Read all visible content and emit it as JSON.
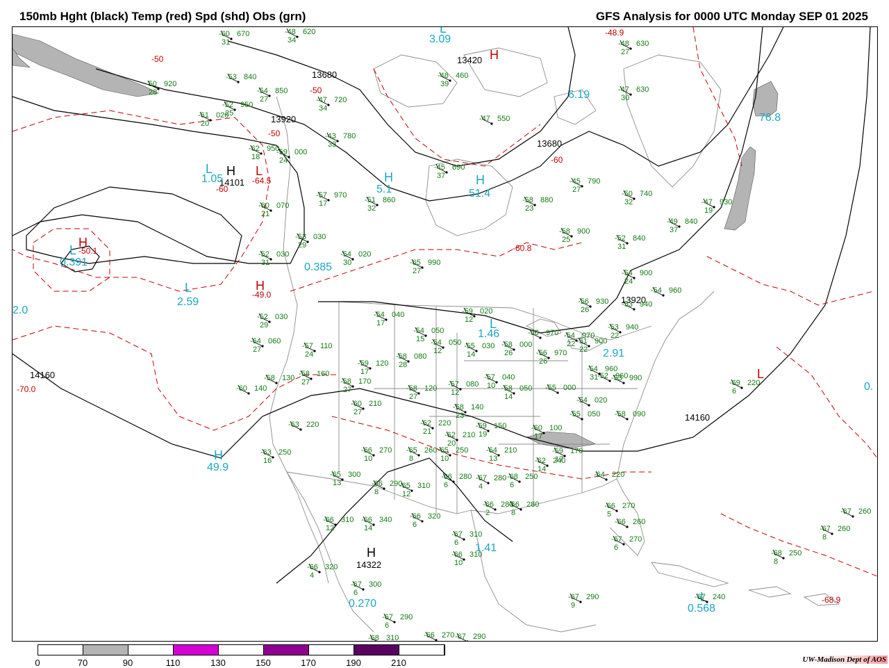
{
  "header": {
    "title_left": "150mb Hght (black) Temp (red) Spd (shd) Obs (grn)",
    "title_right": "GFS Analysis for 0000 UTC Monday  SEP 01 2025"
  },
  "colors": {
    "height_contour": "#000000",
    "temp_contour": "#c00000",
    "obs_text": "#117a11",
    "speed_center_label": "#1aa7c0",
    "map_lines": "#8c8c8c"
  },
  "map": {
    "height_labels": [
      "13680",
      "13920",
      "14101",
      "13920",
      "13680",
      "14160",
      "14160",
      "14322",
      "13420"
    ],
    "temp_labels": [
      "-50",
      "-50",
      "-50",
      "-60",
      "-64.5",
      "-50.1",
      "-49.0",
      "-60.8",
      "-48.9",
      "-70.0",
      "-68.9",
      "-60"
    ],
    "speed_centers": [
      "3.09",
      "6.19",
      "1.05",
      "0.391",
      "2.59",
      "2.0",
      "5.1",
      "51.4",
      "0.385",
      "1.46",
      "2.91",
      "49.9",
      "76.8",
      "1.41",
      "0.270",
      "0.568",
      "0."
    ],
    "pressure_centers": [
      "H",
      "L",
      "H",
      "L",
      "H",
      "L",
      "H",
      "L",
      "H",
      "L",
      "H",
      "L",
      "H",
      "H",
      "L",
      "L"
    ],
    "stations": [
      {
        "t": "-60",
        "h": "670",
        "s": "31"
      },
      {
        "t": "-48",
        "h": "620",
        "s": "34"
      },
      {
        "t": "-50",
        "h": "920",
        "s": "28"
      },
      {
        "t": "-53",
        "h": "840",
        "s": ""
      },
      {
        "t": "-54",
        "h": "850",
        "s": "27"
      },
      {
        "t": "-52",
        "h": "950",
        "s": "25"
      },
      {
        "t": "-61",
        "h": "020",
        "s": "20"
      },
      {
        "t": "-62",
        "h": "950",
        "s": "18"
      },
      {
        "t": "-59",
        "h": "000",
        "s": "24"
      },
      {
        "t": "-47",
        "h": "720",
        "s": "34"
      },
      {
        "t": "-43",
        "h": "780",
        "s": "33"
      },
      {
        "t": "-57",
        "h": "970",
        "s": "17"
      },
      {
        "t": "-51",
        "h": "860",
        "s": "32"
      },
      {
        "t": "-60",
        "h": "070",
        "s": "21"
      },
      {
        "t": "-53",
        "h": "030",
        "s": "29"
      },
      {
        "t": "-54",
        "h": "020",
        "s": "30"
      },
      {
        "t": "-52",
        "h": "030",
        "s": "31"
      },
      {
        "t": "-65",
        "h": "990",
        "s": "27"
      },
      {
        "t": "-48",
        "h": "460",
        "s": "39"
      },
      {
        "t": "-47",
        "h": "550",
        "s": ""
      },
      {
        "t": "-45",
        "h": "690",
        "s": "37"
      },
      {
        "t": "-48",
        "h": "630",
        "s": "27"
      },
      {
        "t": "-47",
        "h": "630",
        "s": "30"
      },
      {
        "t": "-58",
        "h": "880",
        "s": "23"
      },
      {
        "t": "-45",
        "h": "790",
        "s": "27"
      },
      {
        "t": "-50",
        "h": "740",
        "s": "32"
      },
      {
        "t": "-47",
        "h": "930",
        "s": "19"
      },
      {
        "t": "-49",
        "h": "840",
        "s": "37"
      },
      {
        "t": "-58",
        "h": "900",
        "s": "25"
      },
      {
        "t": "-52",
        "h": "840",
        "s": "31"
      },
      {
        "t": "-54",
        "h": "900",
        "s": "24"
      },
      {
        "t": "-54",
        "h": "960",
        "s": ""
      },
      {
        "t": "-56",
        "h": "930",
        "s": "26"
      },
      {
        "t": "-53",
        "h": "940",
        "s": ""
      },
      {
        "t": "-52",
        "h": "030",
        "s": "29"
      },
      {
        "t": "-64",
        "h": "060",
        "s": "27"
      },
      {
        "t": "-57",
        "h": "110",
        "s": "24"
      },
      {
        "t": "-54",
        "h": "040",
        "s": "17"
      },
      {
        "t": "-54",
        "h": "050",
        "s": "15"
      },
      {
        "t": "-54",
        "h": "050",
        "s": "12"
      },
      {
        "t": "-59",
        "h": "020",
        "s": "12"
      },
      {
        "t": "-55",
        "h": "030",
        "s": "14"
      },
      {
        "t": "-58",
        "h": "000",
        "s": "26"
      },
      {
        "t": "-56",
        "h": "970",
        "s": ""
      },
      {
        "t": "-56",
        "h": "970",
        "s": "26"
      },
      {
        "t": "-54",
        "h": "970",
        "s": "22"
      },
      {
        "t": "-53",
        "h": "940",
        "s": "22"
      },
      {
        "t": "-51",
        "h": "900",
        "s": "22"
      },
      {
        "t": "-54",
        "h": "960",
        "s": "31"
      },
      {
        "t": "-52",
        "h": "960",
        "s": ""
      },
      {
        "t": "-53",
        "h": "990",
        "s": ""
      },
      {
        "t": "-58",
        "h": "130",
        "s": ""
      },
      {
        "t": "-58",
        "h": "160",
        "s": "27"
      },
      {
        "t": "-58",
        "h": "170",
        "s": "27"
      },
      {
        "t": "-60",
        "h": "140",
        "s": ""
      },
      {
        "t": "-59",
        "h": "120",
        "s": "17"
      },
      {
        "t": "-58",
        "h": "080",
        "s": "28"
      },
      {
        "t": "-58",
        "h": "120",
        "s": "27"
      },
      {
        "t": "-57",
        "h": "080",
        "s": "12"
      },
      {
        "t": "-57",
        "h": "040",
        "s": "10"
      },
      {
        "t": "-58",
        "h": "050",
        "s": "14"
      },
      {
        "t": "-55",
        "h": "000",
        "s": ""
      },
      {
        "t": "-54",
        "h": "020",
        "s": ""
      },
      {
        "t": "-55",
        "h": "050",
        "s": ""
      },
      {
        "t": "-58",
        "h": "090",
        "s": ""
      },
      {
        "t": "-60",
        "h": "210",
        "s": "27"
      },
      {
        "t": "-58",
        "h": "140",
        "s": "23"
      },
      {
        "t": "-62",
        "h": "220",
        "s": "21"
      },
      {
        "t": "-62",
        "h": "210",
        "s": "20"
      },
      {
        "t": "-59",
        "h": "150",
        "s": "19"
      },
      {
        "t": "-60",
        "h": "100",
        "s": "17"
      },
      {
        "t": "-59",
        "h": "170",
        "s": "17"
      },
      {
        "t": "-63",
        "h": "220",
        "s": ""
      },
      {
        "t": "-63",
        "h": "250",
        "s": "16"
      },
      {
        "t": "-66",
        "h": "270",
        "s": "10"
      },
      {
        "t": "-65",
        "h": "260",
        "s": "8"
      },
      {
        "t": "-65",
        "h": "250",
        "s": "10"
      },
      {
        "t": "-64",
        "h": "210",
        "s": "13"
      },
      {
        "t": "-62",
        "h": "240",
        "s": "14"
      },
      {
        "t": "-65",
        "h": "300",
        "s": "13"
      },
      {
        "t": "-66",
        "h": "290",
        "s": "8"
      },
      {
        "t": "-65",
        "h": "310",
        "s": "12"
      },
      {
        "t": "-66",
        "h": "280",
        "s": "6"
      },
      {
        "t": "-67",
        "h": "280",
        "s": "4"
      },
      {
        "t": "-68",
        "h": "250",
        "s": "6"
      },
      {
        "t": "-64",
        "h": "220",
        "s": ""
      },
      {
        "t": "-66",
        "h": "280",
        "s": "2"
      },
      {
        "t": "-66",
        "h": "280",
        "s": "8"
      },
      {
        "t": "-66",
        "h": "310",
        "s": "12"
      },
      {
        "t": "-66",
        "h": "340",
        "s": "14"
      },
      {
        "t": "-66",
        "h": "320",
        "s": "6"
      },
      {
        "t": "-67",
        "h": "310",
        "s": "6"
      },
      {
        "t": "-66",
        "h": "310",
        "s": "10"
      },
      {
        "t": "-66",
        "h": "320",
        "s": "4"
      },
      {
        "t": "-67",
        "h": "300",
        "s": "6"
      },
      {
        "t": "-67",
        "h": "290",
        "s": "6"
      },
      {
        "t": "-68",
        "h": "310",
        "s": ""
      },
      {
        "t": "-66",
        "h": "270",
        "s": ""
      },
      {
        "t": "-67",
        "h": "290",
        "s": ""
      },
      {
        "t": "-67",
        "h": "290",
        "s": "9"
      },
      {
        "t": "-66",
        "h": "270",
        "s": "5"
      },
      {
        "t": "-66",
        "h": "260",
        "s": ""
      },
      {
        "t": "-67",
        "h": "270",
        "s": "6"
      },
      {
        "t": "-69",
        "h": "220",
        "s": "6"
      },
      {
        "t": "-67",
        "h": "260",
        "s": ""
      },
      {
        "t": "-67",
        "h": "260",
        "s": "8"
      },
      {
        "t": "-68",
        "h": "250",
        "s": "8"
      },
      {
        "t": "-67",
        "h": "240",
        "s": ""
      }
    ]
  },
  "colorbar": {
    "segments": [
      {
        "from": "0",
        "to": "70",
        "color": "#ffffff"
      },
      {
        "from": "70",
        "to": "90",
        "color": "#b4b4b4"
      },
      {
        "from": "90",
        "to": "110",
        "color": "#ffffff"
      },
      {
        "from": "110",
        "to": "130",
        "color": "#d400d4"
      },
      {
        "from": "130",
        "to": "150",
        "color": "#ffffff"
      },
      {
        "from": "150",
        "to": "170",
        "color": "#8f008f"
      },
      {
        "from": "170",
        "to": "190",
        "color": "#ffffff"
      },
      {
        "from": "190",
        "to": "210",
        "color": "#5a0060"
      },
      {
        "from": "210",
        "to": "",
        "color": "#ffffff"
      }
    ],
    "ticks": [
      "0",
      "70",
      "90",
      "110",
      "130",
      "150",
      "170",
      "190",
      "210"
    ]
  },
  "credit": "UW-Madison  Dept of AOS"
}
